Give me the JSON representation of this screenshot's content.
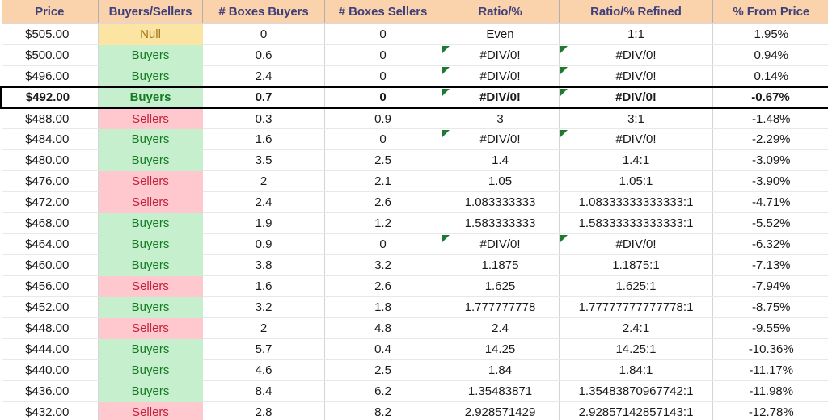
{
  "table": {
    "columns": [
      {
        "key": "price",
        "label": "Price"
      },
      {
        "key": "bs",
        "label": "Buyers/Sellers"
      },
      {
        "key": "boxes_buy",
        "label": "# Boxes Buyers"
      },
      {
        "key": "boxes_sell",
        "label": "# Boxes Sellers"
      },
      {
        "key": "ratio",
        "label": "Ratio/%"
      },
      {
        "key": "ratio_ref",
        "label": "Ratio/% Refined"
      },
      {
        "key": "pct",
        "label": "% From Price"
      }
    ],
    "colors": {
      "header_bg": "#fad2ac",
      "header_text": "#3f3f7a",
      "buyers_bg": "#c6efce",
      "buyers_text": "#157a22",
      "sellers_bg": "#ffc7ce",
      "sellers_text": "#c0223b",
      "null_bg": "#fce5a2",
      "null_text": "#a5761b",
      "error_flag": "#1e7a33",
      "highlight_border": "#000000"
    },
    "rows": [
      {
        "price": "$505.00",
        "bs": "Null",
        "bs_state": "null",
        "boxes_buy": "0",
        "boxes_sell": "0",
        "ratio": "Even",
        "ratio_flag": false,
        "ratio_ref": "1:1",
        "ratio_ref_flag": false,
        "pct": "1.95%",
        "highlight": false
      },
      {
        "price": "$500.00",
        "bs": "Buyers",
        "bs_state": "buyers",
        "boxes_buy": "0.6",
        "boxes_sell": "0",
        "ratio": "#DIV/0!",
        "ratio_flag": true,
        "ratio_ref": "#DIV/0!",
        "ratio_ref_flag": true,
        "pct": "0.94%",
        "highlight": false
      },
      {
        "price": "$496.00",
        "bs": "Buyers",
        "bs_state": "buyers",
        "boxes_buy": "2.4",
        "boxes_sell": "0",
        "ratio": "#DIV/0!",
        "ratio_flag": true,
        "ratio_ref": "#DIV/0!",
        "ratio_ref_flag": true,
        "pct": "0.14%",
        "highlight": false
      },
      {
        "price": "$492.00",
        "bs": "Buyers",
        "bs_state": "buyers",
        "boxes_buy": "0.7",
        "boxes_sell": "0",
        "ratio": "#DIV/0!",
        "ratio_flag": true,
        "ratio_ref": "#DIV/0!",
        "ratio_ref_flag": true,
        "pct": "-0.67%",
        "highlight": true
      },
      {
        "price": "$488.00",
        "bs": "Sellers",
        "bs_state": "sellers",
        "boxes_buy": "0.3",
        "boxes_sell": "0.9",
        "ratio": "3",
        "ratio_flag": false,
        "ratio_ref": "3:1",
        "ratio_ref_flag": false,
        "pct": "-1.48%",
        "highlight": false
      },
      {
        "price": "$484.00",
        "bs": "Buyers",
        "bs_state": "buyers",
        "boxes_buy": "1.6",
        "boxes_sell": "0",
        "ratio": "#DIV/0!",
        "ratio_flag": true,
        "ratio_ref": "#DIV/0!",
        "ratio_ref_flag": true,
        "pct": "-2.29%",
        "highlight": false
      },
      {
        "price": "$480.00",
        "bs": "Buyers",
        "bs_state": "buyers",
        "boxes_buy": "3.5",
        "boxes_sell": "2.5",
        "ratio": "1.4",
        "ratio_flag": false,
        "ratio_ref": "1.4:1",
        "ratio_ref_flag": false,
        "pct": "-3.09%",
        "highlight": false
      },
      {
        "price": "$476.00",
        "bs": "Sellers",
        "bs_state": "sellers",
        "boxes_buy": "2",
        "boxes_sell": "2.1",
        "ratio": "1.05",
        "ratio_flag": false,
        "ratio_ref": "1.05:1",
        "ratio_ref_flag": false,
        "pct": "-3.90%",
        "highlight": false
      },
      {
        "price": "$472.00",
        "bs": "Sellers",
        "bs_state": "sellers",
        "boxes_buy": "2.4",
        "boxes_sell": "2.6",
        "ratio": "1.083333333",
        "ratio_flag": false,
        "ratio_ref": "1.08333333333333:1",
        "ratio_ref_flag": false,
        "pct": "-4.71%",
        "highlight": false
      },
      {
        "price": "$468.00",
        "bs": "Buyers",
        "bs_state": "buyers",
        "boxes_buy": "1.9",
        "boxes_sell": "1.2",
        "ratio": "1.583333333",
        "ratio_flag": false,
        "ratio_ref": "1.58333333333333:1",
        "ratio_ref_flag": false,
        "pct": "-5.52%",
        "highlight": false
      },
      {
        "price": "$464.00",
        "bs": "Buyers",
        "bs_state": "buyers",
        "boxes_buy": "0.9",
        "boxes_sell": "0",
        "ratio": "#DIV/0!",
        "ratio_flag": true,
        "ratio_ref": "#DIV/0!",
        "ratio_ref_flag": true,
        "pct": "-6.32%",
        "highlight": false
      },
      {
        "price": "$460.00",
        "bs": "Buyers",
        "bs_state": "buyers",
        "boxes_buy": "3.8",
        "boxes_sell": "3.2",
        "ratio": "1.1875",
        "ratio_flag": false,
        "ratio_ref": "1.1875:1",
        "ratio_ref_flag": false,
        "pct": "-7.13%",
        "highlight": false
      },
      {
        "price": "$456.00",
        "bs": "Sellers",
        "bs_state": "sellers",
        "boxes_buy": "1.6",
        "boxes_sell": "2.6",
        "ratio": "1.625",
        "ratio_flag": false,
        "ratio_ref": "1.625:1",
        "ratio_ref_flag": false,
        "pct": "-7.94%",
        "highlight": false
      },
      {
        "price": "$452.00",
        "bs": "Buyers",
        "bs_state": "buyers",
        "boxes_buy": "3.2",
        "boxes_sell": "1.8",
        "ratio": "1.777777778",
        "ratio_flag": false,
        "ratio_ref": "1.77777777777778:1",
        "ratio_ref_flag": false,
        "pct": "-8.75%",
        "highlight": false
      },
      {
        "price": "$448.00",
        "bs": "Sellers",
        "bs_state": "sellers",
        "boxes_buy": "2",
        "boxes_sell": "4.8",
        "ratio": "2.4",
        "ratio_flag": false,
        "ratio_ref": "2.4:1",
        "ratio_ref_flag": false,
        "pct": "-9.55%",
        "highlight": false
      },
      {
        "price": "$444.00",
        "bs": "Buyers",
        "bs_state": "buyers",
        "boxes_buy": "5.7",
        "boxes_sell": "0.4",
        "ratio": "14.25",
        "ratio_flag": false,
        "ratio_ref": "14.25:1",
        "ratio_ref_flag": false,
        "pct": "-10.36%",
        "highlight": false
      },
      {
        "price": "$440.00",
        "bs": "Buyers",
        "bs_state": "buyers",
        "boxes_buy": "4.6",
        "boxes_sell": "2.5",
        "ratio": "1.84",
        "ratio_flag": false,
        "ratio_ref": "1.84:1",
        "ratio_ref_flag": false,
        "pct": "-11.17%",
        "highlight": false
      },
      {
        "price": "$436.00",
        "bs": "Buyers",
        "bs_state": "buyers",
        "boxes_buy": "8.4",
        "boxes_sell": "6.2",
        "ratio": "1.35483871",
        "ratio_flag": false,
        "ratio_ref": "1.35483870967742:1",
        "ratio_ref_flag": false,
        "pct": "-11.98%",
        "highlight": false
      },
      {
        "price": "$432.00",
        "bs": "Sellers",
        "bs_state": "sellers",
        "boxes_buy": "2.8",
        "boxes_sell": "8.2",
        "ratio": "2.928571429",
        "ratio_flag": false,
        "ratio_ref": "2.92857142857143:1",
        "ratio_ref_flag": false,
        "pct": "-12.78%",
        "highlight": false
      }
    ]
  }
}
